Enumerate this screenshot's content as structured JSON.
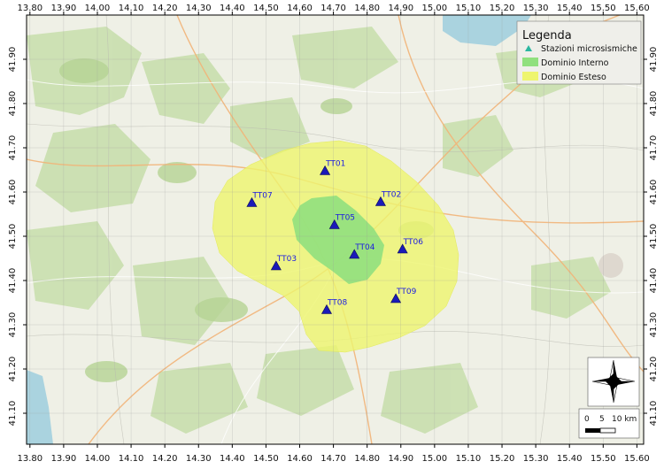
{
  "map": {
    "lon_ticks": [
      "13.80",
      "13.90",
      "14.00",
      "14.10",
      "14.20",
      "14.30",
      "14.40",
      "14.50",
      "14.60",
      "14.70",
      "14.80",
      "14.90",
      "15.00",
      "15.10",
      "15.20",
      "15.30",
      "15.40",
      "15.50",
      "15.60"
    ],
    "lat_ticks": [
      "41.90",
      "41.80",
      "41.70",
      "41.60",
      "41.50",
      "41.40",
      "41.30",
      "41.20",
      "41.10"
    ],
    "lon_range": [
      13.79,
      15.62
    ],
    "lat_range": [
      41.03,
      42.0
    ]
  },
  "legend": {
    "title": "Legenda",
    "items": [
      {
        "label": "Stazioni microsismiche",
        "symbol": "triangle",
        "color": "#2bb7a0"
      },
      {
        "label": "Dominio Interno",
        "symbol": "patch",
        "color": "#90e07e"
      },
      {
        "label": "Dominio Esteso",
        "symbol": "patch",
        "color": "#eef56e"
      }
    ]
  },
  "stations": [
    {
      "name": "TT01",
      "lon": 14.675,
      "lat": 41.647
    },
    {
      "name": "TT02",
      "lon": 14.84,
      "lat": 41.577
    },
    {
      "name": "TT03",
      "lon": 14.53,
      "lat": 41.432
    },
    {
      "name": "TT04",
      "lon": 14.762,
      "lat": 41.458
    },
    {
      "name": "TT05",
      "lon": 14.703,
      "lat": 41.525
    },
    {
      "name": "TT06",
      "lon": 14.905,
      "lat": 41.47
    },
    {
      "name": "TT07",
      "lon": 14.458,
      "lat": 41.575
    },
    {
      "name": "TT08",
      "lon": 14.68,
      "lat": 41.333
    },
    {
      "name": "TT09",
      "lon": 14.885,
      "lat": 41.358
    }
  ],
  "scale_bar": {
    "labels": [
      "0",
      "5",
      "10 km"
    ]
  },
  "colors": {
    "station_fill": "#1a1ab8",
    "station_label": "#1b1be0",
    "inner_domain": "#90e07e",
    "outer_domain": "#eef56e"
  }
}
